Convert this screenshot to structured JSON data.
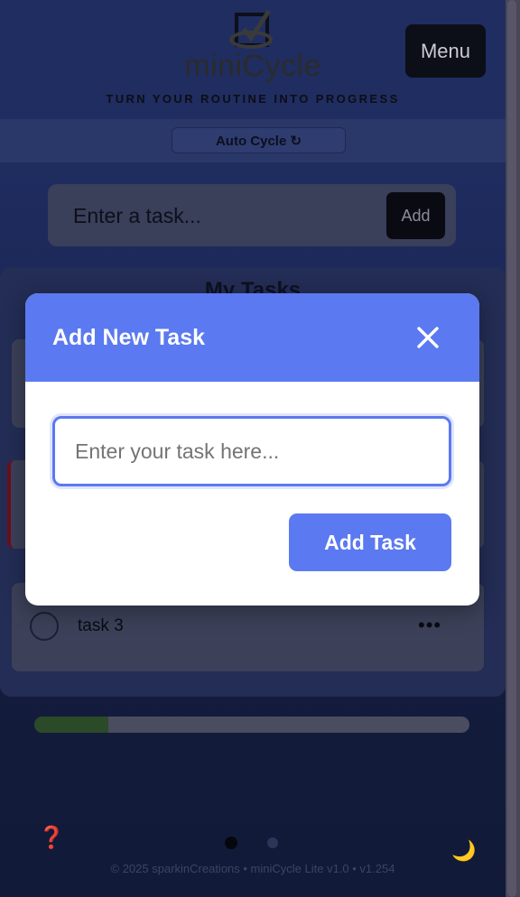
{
  "app": {
    "brand": "miniCycle",
    "tagline": "TURN YOUR ROUTINE INTO PROGRESS",
    "menu_label": "Menu",
    "mode_label": "Auto Cycle ↻",
    "task_input_placeholder": "Enter a task...",
    "add_label": "Add",
    "tasks_title": "My Tasks",
    "tasks": [
      {
        "label": "task 3",
        "more": "•••"
      }
    ],
    "progress_fraction": 0.17,
    "help_icon": "❓",
    "theme_icon": "🌙",
    "footer": "© 2025 sparkinCreations • miniCycle Lite v1.0 • v1.254"
  },
  "modal": {
    "title": "Add New Task",
    "close_icon": "close-icon",
    "input_placeholder": "Enter your task here...",
    "input_value": "",
    "submit_label": "Add Task"
  },
  "colors": {
    "accent": "#5b79f0",
    "background": "#1f2d61",
    "overdue": "#6b1020",
    "progress": "#2a4a28"
  }
}
